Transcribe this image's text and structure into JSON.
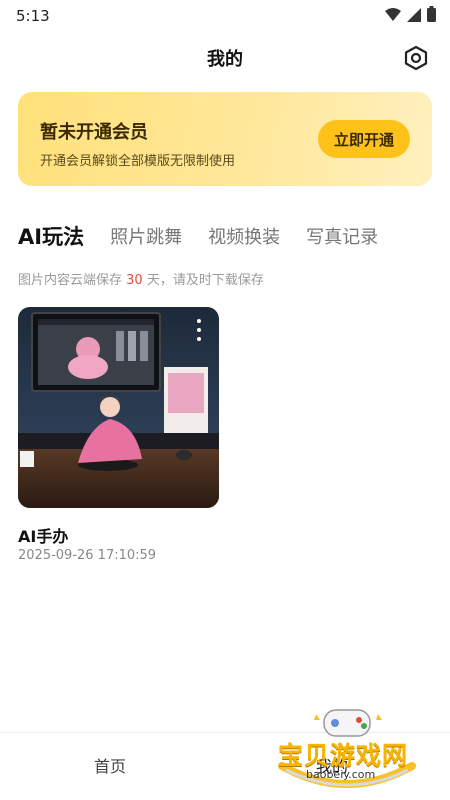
{
  "status_bar": {
    "time": "5:13"
  },
  "header": {
    "title": "我的",
    "settings_icon": "settings-hexagon-icon"
  },
  "member_banner": {
    "title": "暂未开通会员",
    "description": "开通会员解锁全部模版无限制使用",
    "button_label": "立即开通"
  },
  "tabs": [
    {
      "label": "AI玩法",
      "active": true
    },
    {
      "label": "照片跳舞",
      "active": false
    },
    {
      "label": "视频换装",
      "active": false
    },
    {
      "label": "写真记录",
      "active": false
    }
  ],
  "notice": {
    "prefix": "图片内容云端保存 ",
    "days": "30",
    "suffix": " 天，请及时下载保存"
  },
  "cards": [
    {
      "title": "AI手办",
      "date": "2025-09-26 17:10:59"
    }
  ],
  "bottom_nav": {
    "home_label": "首页",
    "mine_label": "我的"
  },
  "watermark": {
    "text": "宝贝游戏网",
    "url": "baobeiy.com"
  },
  "colors": {
    "banner_bg": "#ffe17a",
    "banner_button": "#ffc21a",
    "notice_highlight": "#e94b3c"
  }
}
